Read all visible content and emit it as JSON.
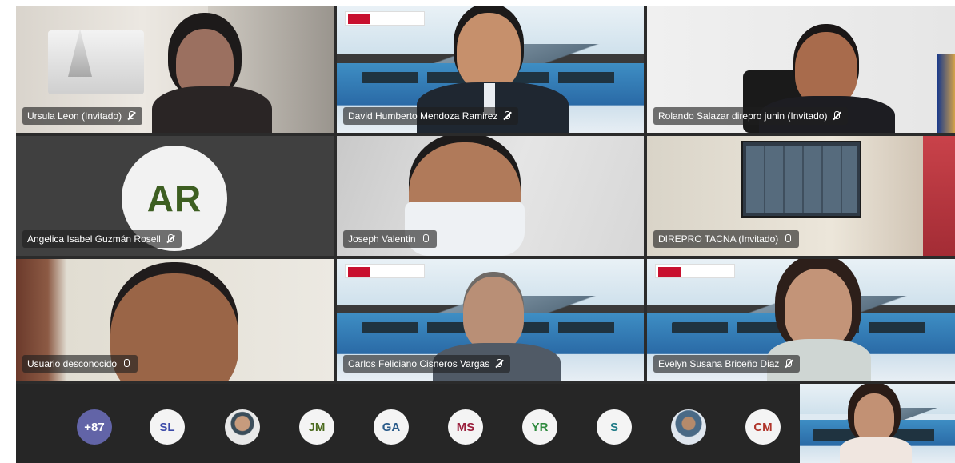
{
  "tiles": [
    {
      "name": "Ursula Leon (Invitado)",
      "muted": true
    },
    {
      "name": "David Humberto Mendoza Ramirez",
      "muted": true
    },
    {
      "name": "Rolando Salazar direpro junin (Invitado)",
      "muted": true
    },
    {
      "name": "Angelica Isabel Guzmán Rosell",
      "muted": true,
      "initials": "AR"
    },
    {
      "name": "Joseph Valentin",
      "muted": false
    },
    {
      "name": "DIREPRO TACNA (Invitado)",
      "muted": false
    },
    {
      "name": "Usuario desconocido",
      "muted": false
    },
    {
      "name": "Carlos Feliciano Cisneros Vargas",
      "muted": true
    },
    {
      "name": "Evelyn Susana Briceño Diaz",
      "muted": true
    }
  ],
  "participants_bar": [
    {
      "label": "+87",
      "color": "#6264a7",
      "text_color": "#ffffff"
    },
    {
      "label": "SL",
      "color": "#f4f4f4",
      "text_color": "#3b4aa8"
    },
    {
      "label": "",
      "photo": true
    },
    {
      "label": "JM",
      "color": "#f4f4f4",
      "text_color": "#4c6b1f"
    },
    {
      "label": "GA",
      "color": "#f4f4f4",
      "text_color": "#2a5b8a"
    },
    {
      "label": "MS",
      "color": "#f4f4f4",
      "text_color": "#9a1f3c"
    },
    {
      "label": "YR",
      "color": "#f4f4f4",
      "text_color": "#2f8a3e"
    },
    {
      "label": "S",
      "color": "#f4f4f4",
      "text_color": "#1f7a86"
    },
    {
      "label": "",
      "photo": true
    },
    {
      "label": "CM",
      "color": "#f4f4f4",
      "text_color": "#b0352b"
    }
  ]
}
